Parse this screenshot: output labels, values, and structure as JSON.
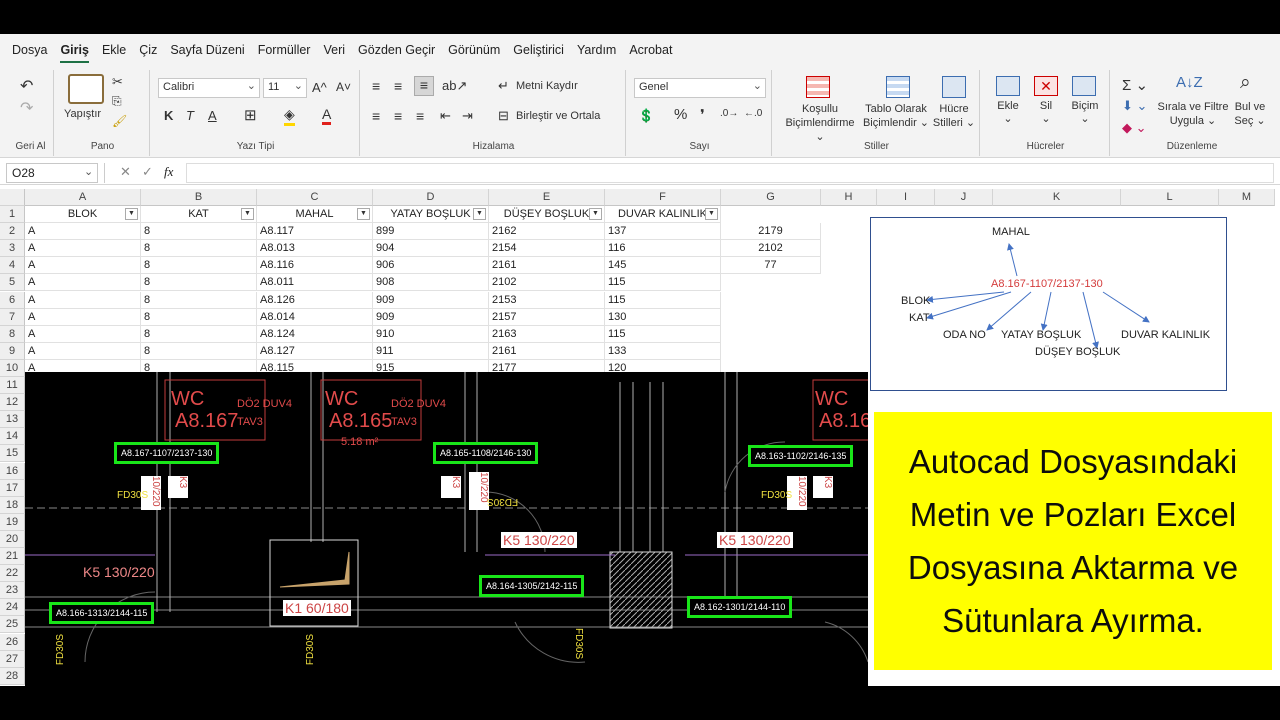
{
  "menu": {
    "tabs": [
      "Dosya",
      "Giriş",
      "Ekle",
      "Çiz",
      "Sayfa Düzeni",
      "Formüller",
      "Veri",
      "Gözden Geçir",
      "Görünüm",
      "Geliştirici",
      "Yardım",
      "Acrobat"
    ],
    "active": "Giriş"
  },
  "ribbon": {
    "undo": {
      "label": "Geri Al"
    },
    "clipboard": {
      "label": "Pano",
      "paste": "Yapıştır"
    },
    "font": {
      "label": "Yazı Tipi",
      "family": "Calibri",
      "size": "11"
    },
    "alignment": {
      "label": "Hizalama",
      "wrap": "Metni Kaydır",
      "merge": "Birleştir ve Ortala"
    },
    "number": {
      "label": "Sayı",
      "format": "Genel"
    },
    "styles": {
      "label": "Stiller",
      "conditional": [
        "Koşullu",
        "Biçimlendirme"
      ],
      "table": [
        "Tablo Olarak",
        "Biçimlendir"
      ],
      "cell": [
        "Hücre",
        "Stilleri"
      ]
    },
    "cells": {
      "label": "Hücreler",
      "insert": "Ekle",
      "delete": "Sil",
      "format": "Biçim"
    },
    "editing": {
      "label": "Düzenleme",
      "sort": [
        "Sırala ve Filtre",
        "Uygula"
      ],
      "find": [
        "Bul ve",
        "Seç"
      ]
    }
  },
  "formula": {
    "namebox": "O28",
    "fx": "fx"
  },
  "columns": [
    "A",
    "B",
    "C",
    "D",
    "E",
    "F",
    "G",
    "H",
    "I",
    "J",
    "K",
    "L",
    "M"
  ],
  "rows": [
    "1",
    "2",
    "3",
    "4",
    "5",
    "6",
    "7",
    "8",
    "9",
    "10",
    "11",
    "12",
    "13",
    "14",
    "15",
    "16",
    "17",
    "18",
    "19",
    "20",
    "21",
    "22",
    "23",
    "24",
    "25",
    "26",
    "27",
    "28"
  ],
  "headers": [
    "BLOK",
    "KAT",
    "MAHAL",
    "YATAY BOŞLUK",
    "DÜŞEY BOŞLUK",
    "DUVAR KALINLIK"
  ],
  "table": [
    [
      "A",
      "8",
      "A8.117",
      "899",
      "2162",
      "137"
    ],
    [
      "A",
      "8",
      "A8.013",
      "904",
      "2154",
      "116"
    ],
    [
      "A",
      "8",
      "A8.116",
      "906",
      "2161",
      "145"
    ],
    [
      "A",
      "8",
      "A8.011",
      "908",
      "2102",
      "115"
    ],
    [
      "A",
      "8",
      "A8.126",
      "909",
      "2153",
      "115"
    ],
    [
      "A",
      "8",
      "A8.014",
      "909",
      "2157",
      "130"
    ],
    [
      "A",
      "8",
      "A8.124",
      "910",
      "2163",
      "115"
    ],
    [
      "A",
      "8",
      "A8.127",
      "911",
      "2161",
      "133"
    ],
    [
      "A",
      "8",
      "A8.115",
      "915",
      "2177",
      "120"
    ]
  ],
  "colG": [
    "2179",
    "2102",
    "77"
  ],
  "diagram": {
    "center": "A8.167-1107/2137-130",
    "mahal": "MAHAL",
    "blok": "BLOK",
    "kat": "KAT",
    "oda": "ODA NO",
    "yatay": "YATAY BOŞLUK",
    "dusey": "DÜŞEY BOŞLUK",
    "duvar": "DUVAR KALINLIK"
  },
  "cad": {
    "rooms": [
      {
        "name": "WC",
        "code": "A8.167",
        "extra": "DÖ2 DUV4",
        "tav": "TAV3",
        "area": "5.18 m²"
      },
      {
        "name": "WC",
        "code": "A8.165",
        "extra": "DÖ2 DUV4",
        "tav": "TAV3",
        "area": "5.18 m²"
      },
      {
        "name": "WC",
        "code": "A8.16",
        "extra": "",
        "tav": "",
        "area": ""
      }
    ],
    "tags": [
      "A8.167-1107/2137-130",
      "A8.165-1108/2146-130",
      "A8.163-1102/2146-135",
      "A8.166-1313/2144-115",
      "A8.164-1305/2142-115",
      "A8.162-1301/2144-110"
    ],
    "red": [
      "K5 130/220",
      "K5 130/220",
      "K5 130/220",
      "K1 60/180",
      "10/220",
      "10/220",
      "10/220",
      "K3",
      "K3",
      "K3"
    ],
    "fd": [
      "FD30S",
      "FD30S",
      "FD30S",
      "FD30S",
      "FD30S",
      "FD30S"
    ]
  },
  "promo": {
    "lines": [
      "Autocad Dosyasındaki",
      "Metin ve Pozları Excel",
      "Dosyasına Aktarma ve",
      "Sütunlara Ayırma."
    ]
  }
}
